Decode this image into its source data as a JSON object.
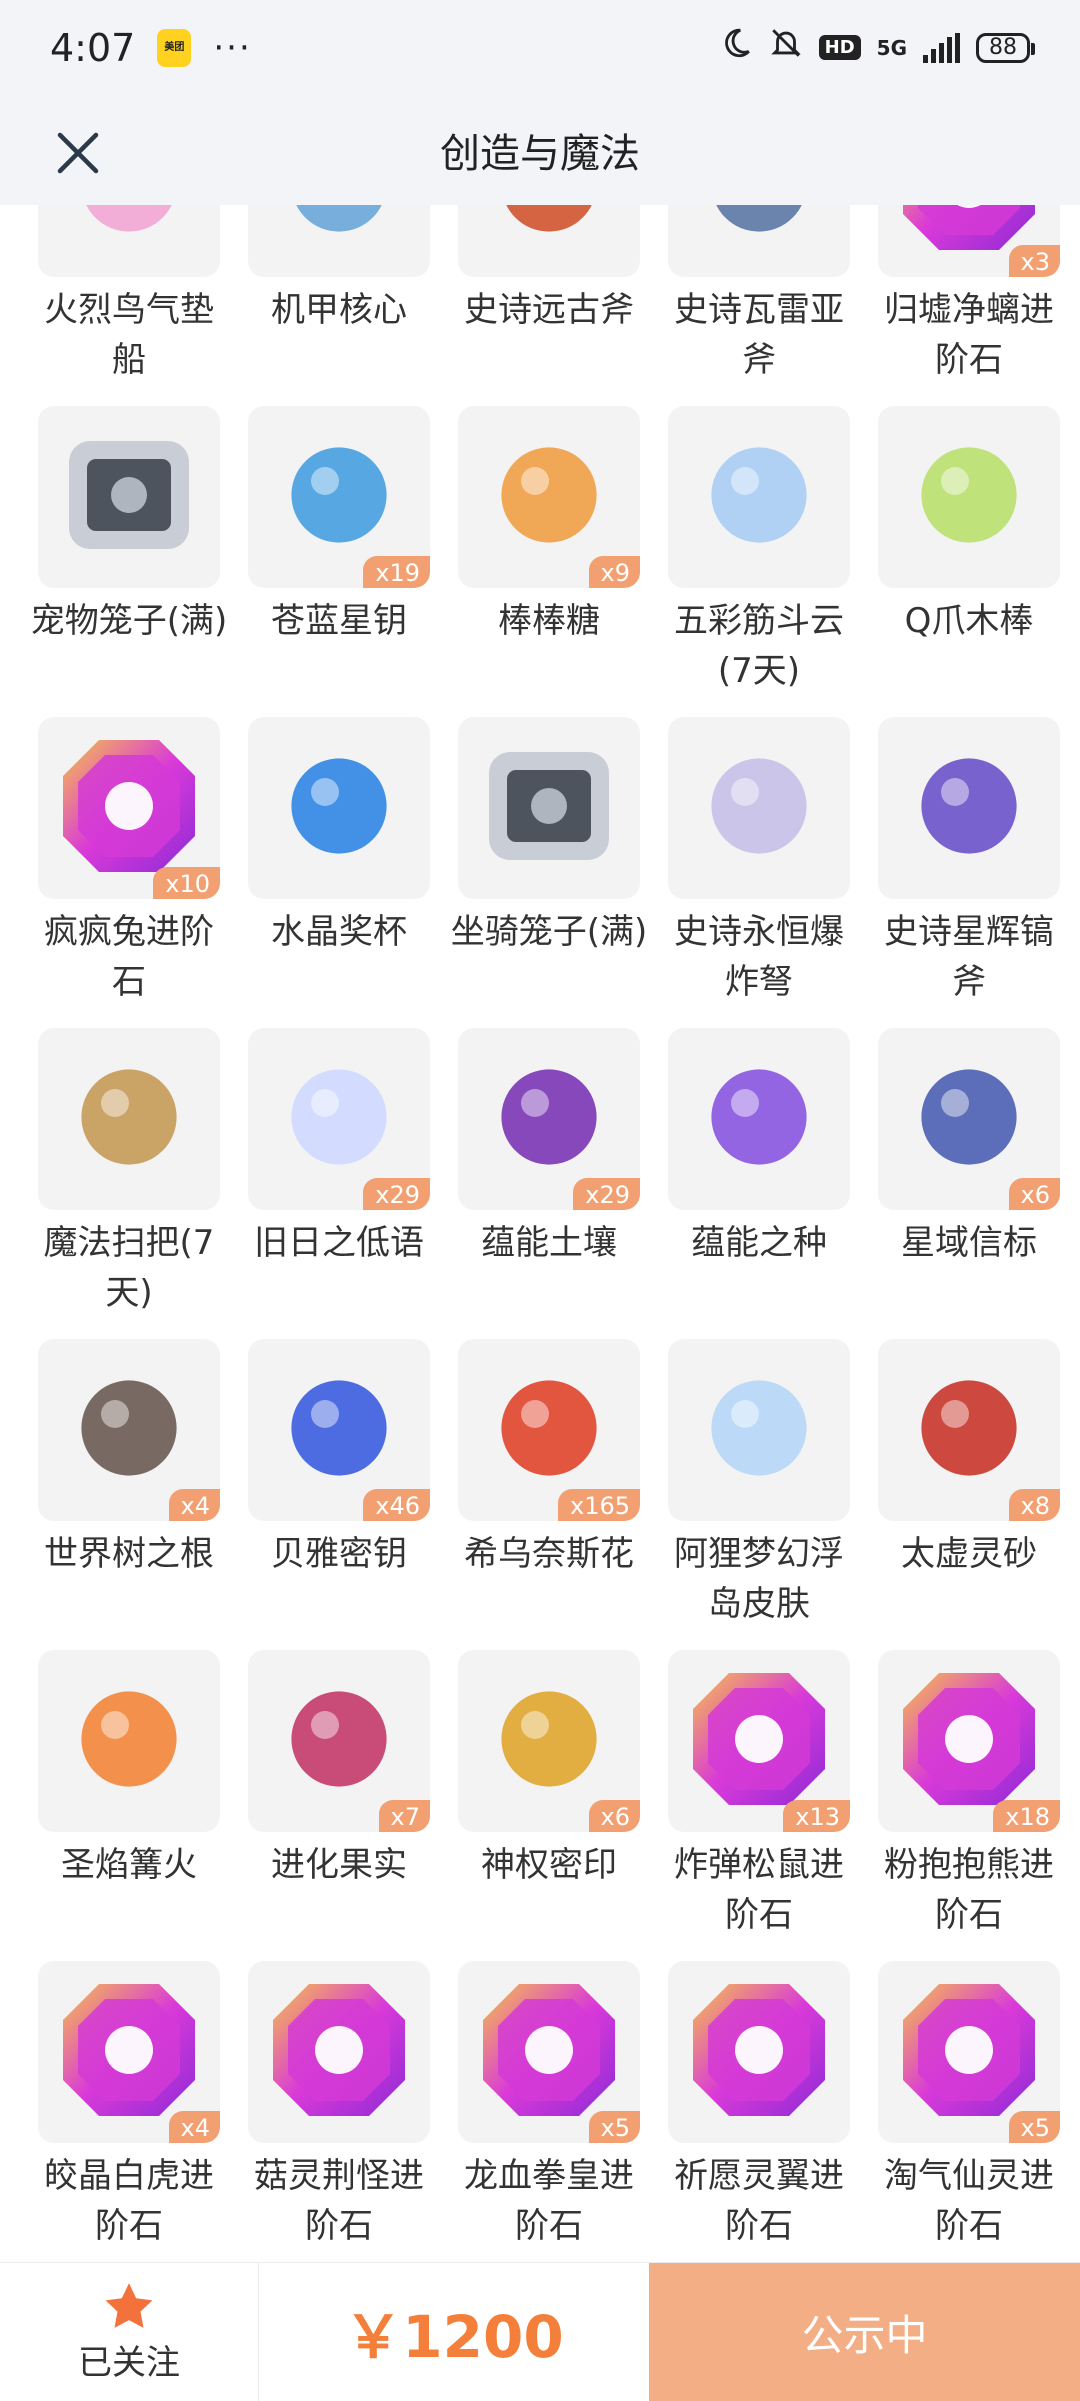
{
  "status_bar": {
    "time": "4:07",
    "app_badge": "美团",
    "more": "···",
    "net": "5G",
    "hd": "HD",
    "battery": "88"
  },
  "header": {
    "title": "创造与魔法"
  },
  "items": [
    {
      "name": "火烈鸟气垫船",
      "badge": "",
      "icon": "flamingo-boat-icon",
      "color": "#f3a6d4"
    },
    {
      "name": "机甲核心",
      "badge": "",
      "icon": "mech-core-icon",
      "color": "#6aa6d8"
    },
    {
      "name": "史诗远古斧",
      "badge": "",
      "icon": "ancient-axe-icon",
      "color": "#d1542f"
    },
    {
      "name": "史诗瓦雷亚斧",
      "badge": "",
      "icon": "varea-axe-icon",
      "color": "#5b78a6"
    },
    {
      "name": "归墟净螭进阶石",
      "badge": "x3",
      "icon": "gem-icon",
      "color": "#d43ad6"
    },
    {
      "name": "宠物笼子(满)",
      "badge": "",
      "icon": "pet-cage-icon",
      "color": "#8a8f99"
    },
    {
      "name": "苍蓝星钥",
      "badge": "x19",
      "icon": "blue-key-icon",
      "color": "#46a0e0"
    },
    {
      "name": "棒棒糖",
      "badge": "x9",
      "icon": "lollipop-icon",
      "color": "#f1a045"
    },
    {
      "name": "五彩筋斗云(7天)",
      "badge": "",
      "icon": "cloud-icon",
      "color": "#a9cdf4"
    },
    {
      "name": "Q爪木棒",
      "badge": "",
      "icon": "hammer-icon",
      "color": "#b9e06e"
    },
    {
      "name": "疯疯兔进阶石",
      "badge": "x10",
      "icon": "gem-icon",
      "color": "#d43ad6"
    },
    {
      "name": "水晶奖杯",
      "badge": "",
      "icon": "crystal-trophy-icon",
      "color": "#2f86e6"
    },
    {
      "name": "坐骑笼子(满)",
      "badge": "",
      "icon": "mount-cage-icon",
      "color": "#8a8f99"
    },
    {
      "name": "史诗永恒爆炸弩",
      "badge": "",
      "icon": "crossbow-icon",
      "color": "#c7c0e8"
    },
    {
      "name": "史诗星辉镐斧",
      "badge": "",
      "icon": "pickaxe-icon",
      "color": "#6a52c9"
    },
    {
      "name": "魔法扫把(7天)",
      "badge": "",
      "icon": "broom-icon",
      "color": "#c59a57"
    },
    {
      "name": "旧日之低语",
      "badge": "x29",
      "icon": "orb-icon",
      "color": "#cfd9ff"
    },
    {
      "name": "蕴能土壤",
      "badge": "x29",
      "icon": "soil-icon",
      "color": "#7a35b5"
    },
    {
      "name": "蕴能之种",
      "badge": "",
      "icon": "crystal-seed-icon",
      "color": "#8a55e0"
    },
    {
      "name": "星域信标",
      "badge": "x6",
      "icon": "beacon-icon",
      "color": "#4b5fb2"
    },
    {
      "name": "世界树之根",
      "badge": "x4",
      "icon": "tree-root-icon",
      "color": "#6a5a52"
    },
    {
      "name": "贝雅密钥",
      "badge": "x46",
      "icon": "card-key-icon",
      "color": "#3b5de0"
    },
    {
      "name": "希乌奈斯花",
      "badge": "x165",
      "icon": "flower-icon",
      "color": "#e0452b"
    },
    {
      "name": "阿狸梦幻浮岛皮肤",
      "badge": "",
      "icon": "floating-island-icon",
      "color": "#b6d7f7"
    },
    {
      "name": "太虚灵砂",
      "badge": "x8",
      "icon": "spirit-sand-icon",
      "color": "#c9352a"
    },
    {
      "name": "圣焰篝火",
      "badge": "",
      "icon": "campfire-icon",
      "color": "#f3863a"
    },
    {
      "name": "进化果实",
      "badge": "x7",
      "icon": "berry-icon",
      "color": "#c43a6a"
    },
    {
      "name": "神权密印",
      "badge": "x6",
      "icon": "seal-coin-icon",
      "color": "#e0a52e"
    },
    {
      "name": "炸弹松鼠进阶石",
      "badge": "x13",
      "icon": "gem-icon",
      "color": "#d43ad6"
    },
    {
      "name": "粉抱抱熊进阶石",
      "badge": "x18",
      "icon": "gem-icon",
      "color": "#d43ad6"
    },
    {
      "name": "皎晶白虎进阶石",
      "badge": "x4",
      "icon": "gem-icon",
      "color": "#d43ad6"
    },
    {
      "name": "菇灵荆怪进阶石",
      "badge": "",
      "icon": "gem-icon",
      "color": "#d43ad6"
    },
    {
      "name": "龙血拳皇进阶石",
      "badge": "x5",
      "icon": "gem-icon",
      "color": "#d43ad6"
    },
    {
      "name": "祈愿灵翼进阶石",
      "badge": "",
      "icon": "gem-icon",
      "color": "#d43ad6"
    },
    {
      "name": "淘气仙灵进阶石",
      "badge": "x5",
      "icon": "gem-icon",
      "color": "#d43ad6"
    }
  ],
  "bottom_bar": {
    "follow_label": "已关注",
    "price": "￥1200",
    "cta_label": "公示中"
  },
  "colors": {
    "accent": "#f47f3a",
    "cta_bg": "#f3ae86",
    "badge_bg": "#f2a071"
  }
}
